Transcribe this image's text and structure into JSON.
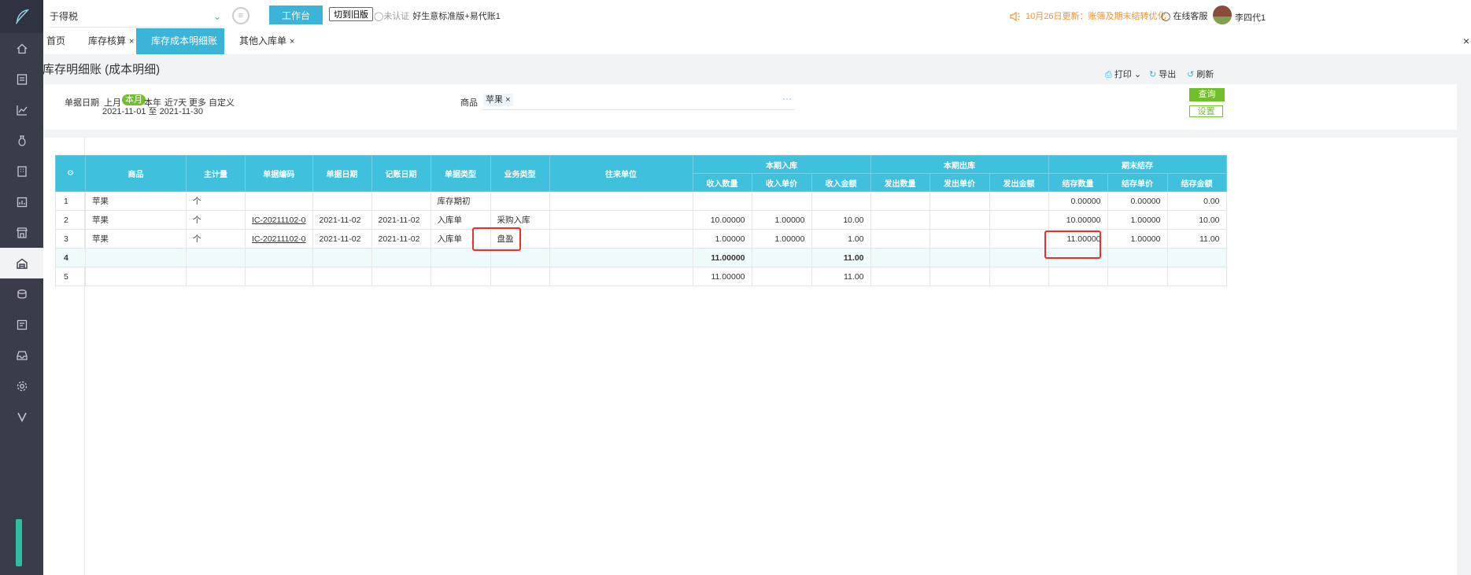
{
  "app": {
    "company": "于得税",
    "workbench_label": "工作台",
    "old_version_label": "切到旧版",
    "cert_status": "未认证",
    "product_name": "好生意标准版+易代账1",
    "notice": "10月26日更新：账簿及期末结转优化",
    "support_label": "在线客服",
    "username": "李四代1"
  },
  "sidebar": {
    "items": [
      "home-icon",
      "voucher-icon",
      "chart-icon",
      "money-bag-icon",
      "building-icon",
      "report-icon",
      "store-icon",
      "warehouse-icon",
      "stack-icon",
      "invoice-icon",
      "inbox-icon",
      "gear-icon",
      "v-icon"
    ],
    "active_index": 7
  },
  "tabs": [
    {
      "label": "首页",
      "closable": false,
      "active": false
    },
    {
      "label": "库存核算",
      "closable": true,
      "active": false
    },
    {
      "label": "库存成本明细账",
      "closable": true,
      "active": true
    },
    {
      "label": "其他入库单",
      "closable": true,
      "active": false
    }
  ],
  "page": {
    "title": "库存明细账 (成本明细)",
    "toolbar": {
      "print": "打印",
      "export": "导出",
      "refresh": "刷新"
    }
  },
  "filter": {
    "date_label": "单据日期",
    "date_options": [
      "上月",
      "本月",
      "本年",
      "近7天",
      "更多",
      "自定义"
    ],
    "active_option": "本月",
    "date_range": "2021-11-01 至 2021-11-30",
    "goods_label": "商品",
    "goods_tag": "苹果",
    "query_button": "查询",
    "setting_button": "设置"
  },
  "table": {
    "columns": [
      "商品",
      "主计量",
      "单据编码",
      "单据日期",
      "记账日期",
      "单据类型",
      "业务类型",
      "往来单位"
    ],
    "groups": [
      {
        "label": "本期入库",
        "subs": [
          "收入数量",
          "收入单价",
          "收入金额"
        ]
      },
      {
        "label": "本期出库",
        "subs": [
          "发出数量",
          "发出单价",
          "发出金额"
        ]
      },
      {
        "label": "期末结存",
        "subs": [
          "结存数量",
          "结存单价",
          "结存金额"
        ]
      }
    ],
    "rows": [
      {
        "idx": "1",
        "goods": "苹果",
        "unit": "个",
        "code": "",
        "date": "",
        "post_date": "",
        "doc_type": "库存期初",
        "biz_type": "",
        "partner": "",
        "in_qty": "",
        "in_price": "",
        "in_amt": "",
        "out_qty": "",
        "out_price": "",
        "out_amt": "",
        "bal_qty": "0.00000",
        "bal_price": "0.00000",
        "bal_amt": "0.00"
      },
      {
        "idx": "2",
        "goods": "苹果",
        "unit": "个",
        "code": "IC-20211102-0",
        "date": "2021-11-02",
        "post_date": "2021-11-02",
        "doc_type": "入库单",
        "biz_type": "采购入库",
        "partner": "",
        "in_qty": "10.00000",
        "in_price": "1.00000",
        "in_amt": "10.00",
        "out_qty": "",
        "out_price": "",
        "out_amt": "",
        "bal_qty": "10.00000",
        "bal_price": "1.00000",
        "bal_amt": "10.00"
      },
      {
        "idx": "3",
        "goods": "苹果",
        "unit": "个",
        "code": "IC-20211102-0",
        "date": "2021-11-02",
        "post_date": "2021-11-02",
        "doc_type": "入库单",
        "biz_type": "盘盈",
        "partner": "",
        "in_qty": "1.00000",
        "in_price": "1.00000",
        "in_amt": "1.00",
        "out_qty": "",
        "out_price": "",
        "out_amt": "",
        "bal_qty": "11.00000",
        "bal_price": "1.00000",
        "bal_amt": "11.00"
      },
      {
        "idx": "4",
        "goods": "",
        "unit": "",
        "code": "",
        "date": "",
        "post_date": "",
        "doc_type": "",
        "biz_type": "",
        "partner": "",
        "in_qty": "11.00000",
        "in_price": "",
        "in_amt": "11.00",
        "out_qty": "",
        "out_price": "",
        "out_amt": "",
        "bal_qty": "",
        "bal_price": "",
        "bal_amt": ""
      },
      {
        "idx": "5",
        "goods": "",
        "unit": "",
        "code": "",
        "date": "",
        "post_date": "",
        "doc_type": "",
        "biz_type": "",
        "partner": "",
        "in_qty": "11.00000",
        "in_price": "",
        "in_amt": "11.00",
        "out_qty": "",
        "out_price": "",
        "out_amt": "",
        "bal_qty": "",
        "bal_price": "",
        "bal_amt": ""
      }
    ]
  },
  "colors": {
    "accent": "#3bb4d8",
    "green": "#72bf2c",
    "highlight": "#e8302f",
    "sidebar": "#393d49"
  }
}
